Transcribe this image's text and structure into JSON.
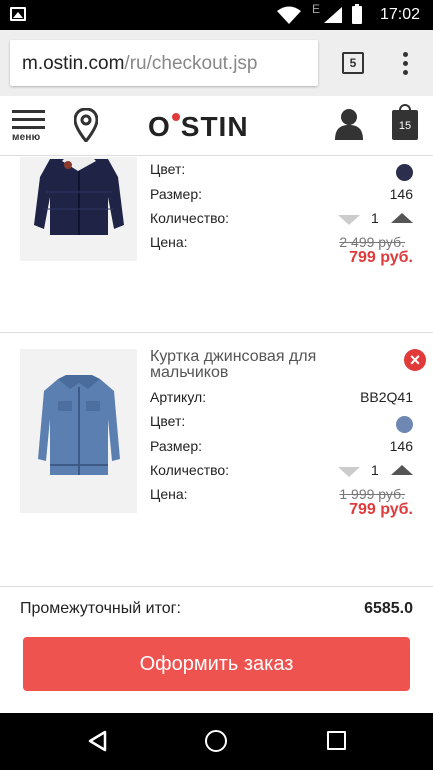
{
  "status_bar": {
    "time": "17:02",
    "network_label": "E",
    "icons": [
      "image-icon",
      "wifi-icon",
      "signal-icon",
      "battery-icon"
    ]
  },
  "browser": {
    "url_host": "m.ostin.com",
    "url_path": "/ru/checkout.jsp",
    "tab_count": "5"
  },
  "header": {
    "menu_label": "меню",
    "logo_text_left": "O",
    "logo_text_right": "STIN",
    "cart_count": "15"
  },
  "products": [
    {
      "name": "",
      "color_label": "Цвет:",
      "color_hex": "#2b2f4d",
      "size_label": "Размер:",
      "size": "146",
      "qty_label": "Количество:",
      "qty": "1",
      "price_label": "Цена:",
      "old_price": "2 499 руб.",
      "new_price": "799 руб."
    },
    {
      "name": "Куртка джинсовая для мальчиков",
      "sku_label": "Артикул:",
      "sku": "BB2Q41",
      "color_label": "Цвет:",
      "color_hex": "#6e87b3",
      "size_label": "Размер:",
      "size": "146",
      "qty_label": "Количество:",
      "qty": "1",
      "price_label": "Цена:",
      "old_price": "1 999 руб.",
      "new_price": "799 руб."
    }
  ],
  "summary": {
    "subtotal_label": "Промежуточный итог:",
    "subtotal_value": "6585.0",
    "checkout_label": "Оформить заказ"
  },
  "colors": {
    "accent": "#ef5350",
    "price_red": "#e03a3a"
  }
}
